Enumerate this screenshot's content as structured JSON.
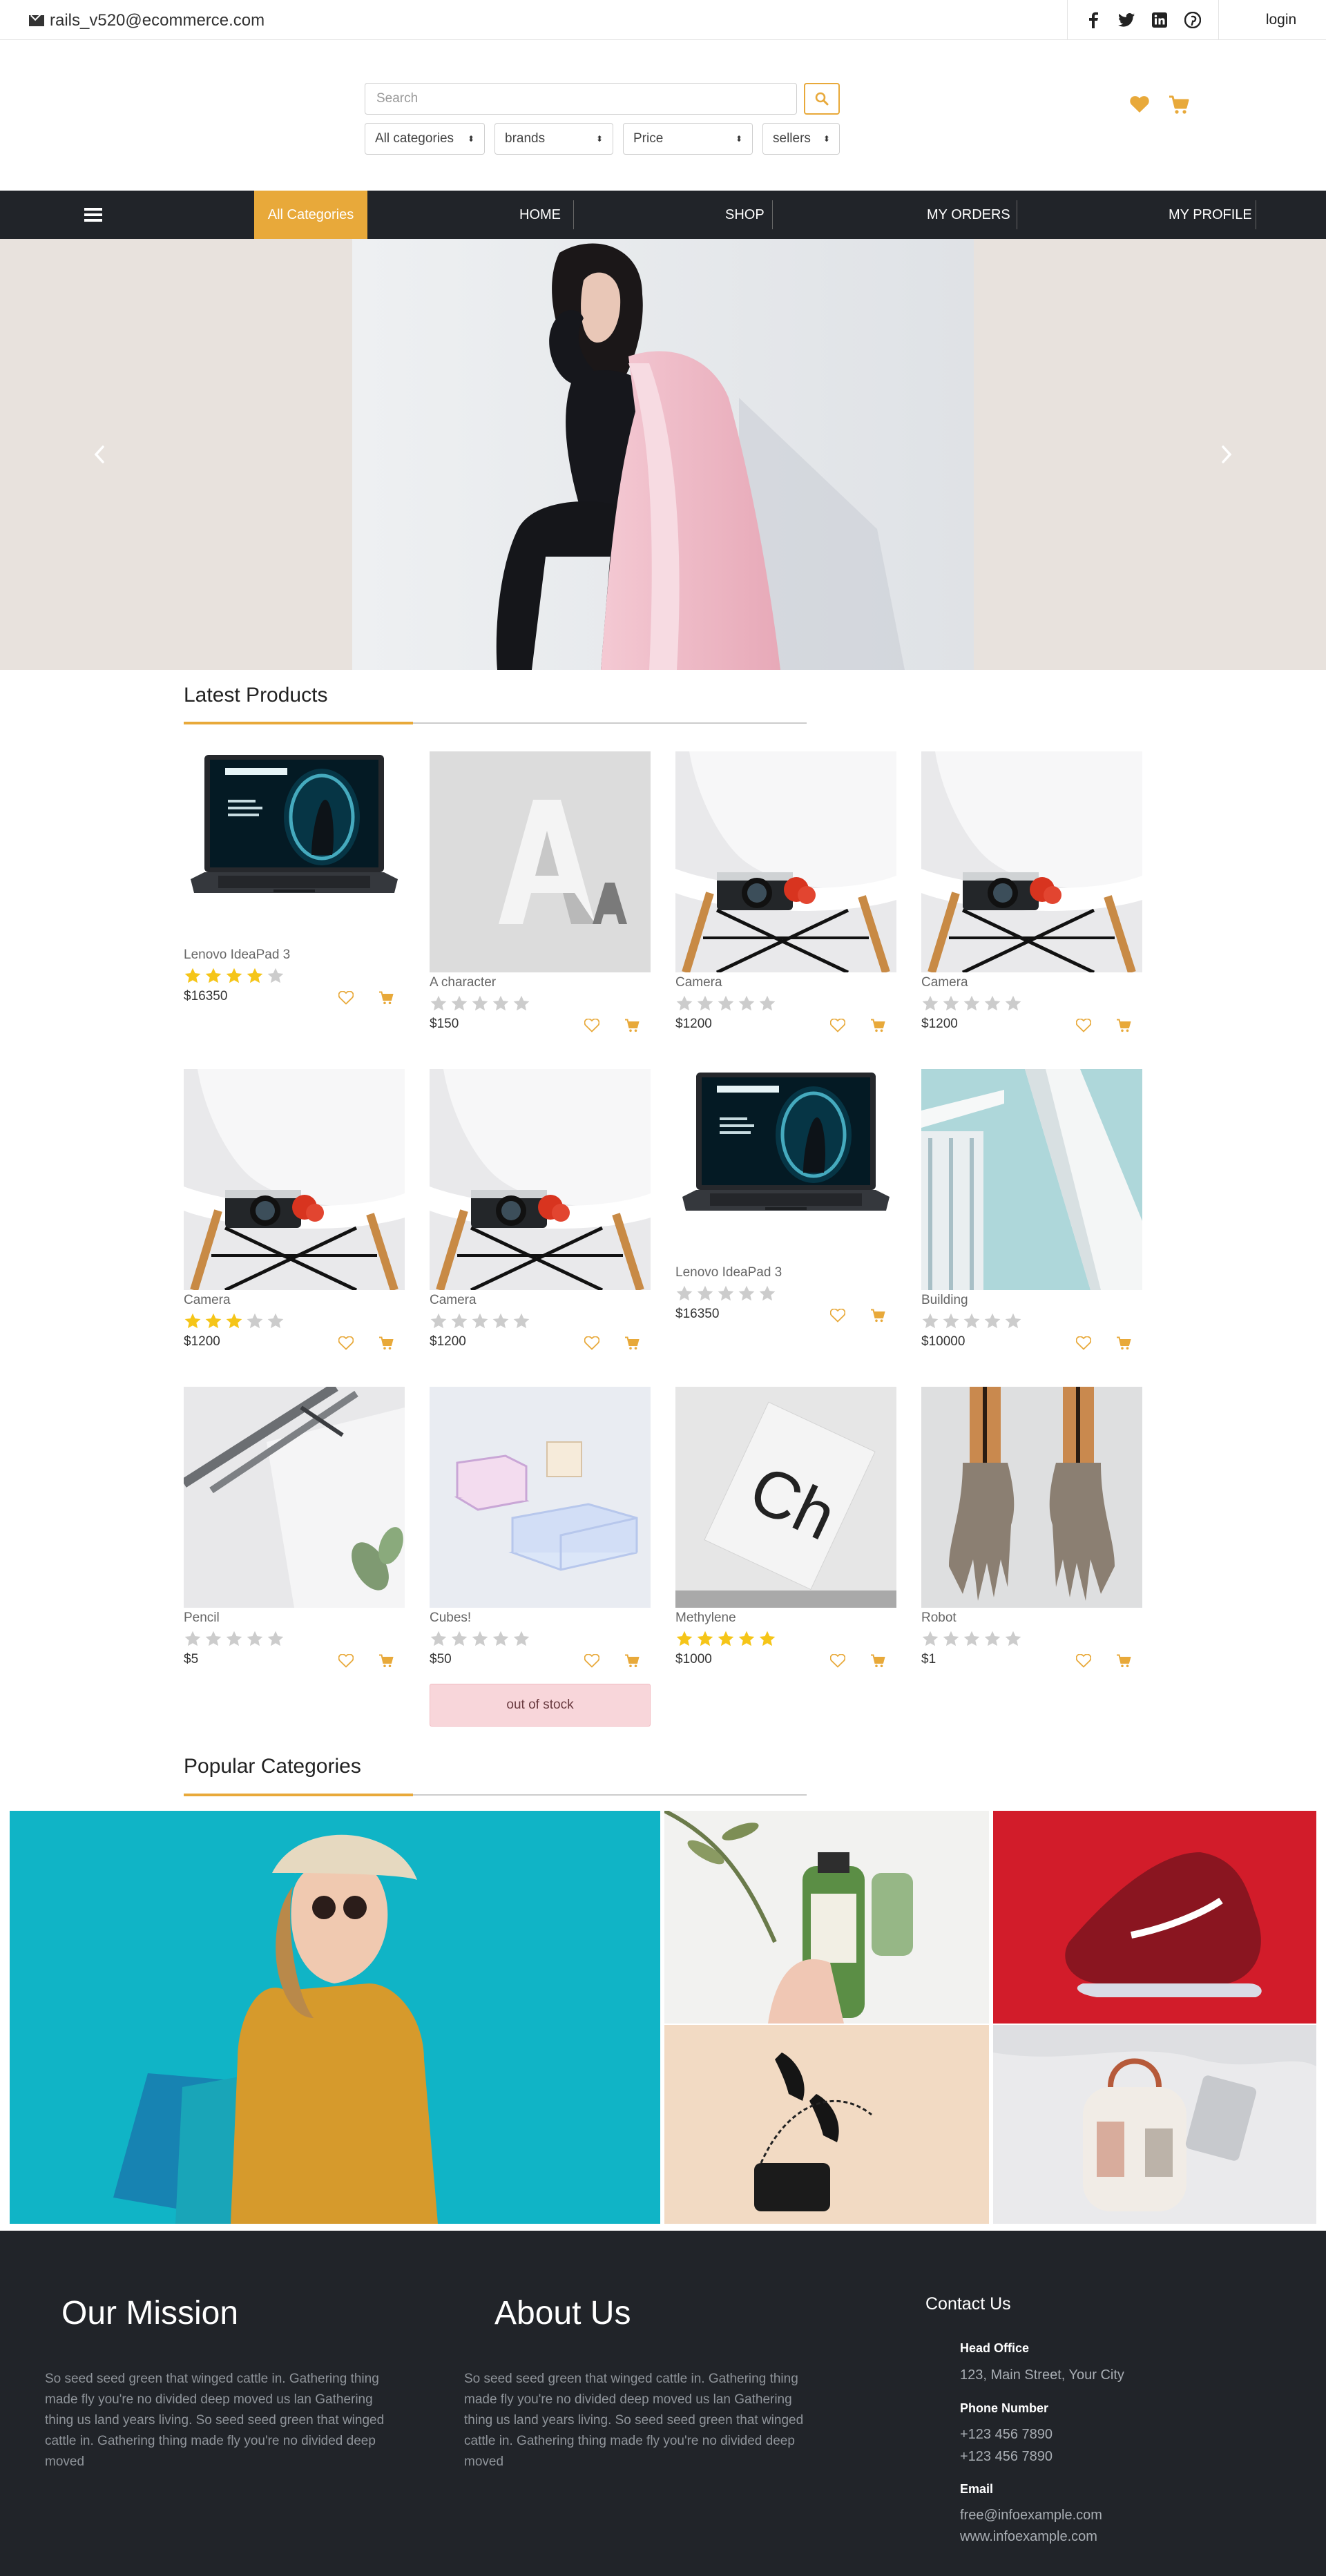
{
  "topbar": {
    "email": "rails_v520@ecommerce.com",
    "login_label": "login",
    "socials": [
      "facebook-icon",
      "twitter-icon",
      "linkedin-icon",
      "pinterest-icon"
    ]
  },
  "search": {
    "placeholder": "Search",
    "filters": [
      "All categories",
      "brands",
      "Price",
      "sellers"
    ]
  },
  "nav": {
    "all_categories": "All Categories",
    "items": [
      "HOME",
      "SHOP",
      "MY ORDERS",
      "MY PROFILE"
    ]
  },
  "sections": {
    "latest": "Latest Products",
    "popular": "Popular Categories"
  },
  "products": [
    {
      "name": "Lenovo IdeaPad 3",
      "rating": 4,
      "price": "$16350",
      "image": "laptop"
    },
    {
      "name": "A character",
      "rating": 0,
      "price": "$150",
      "image": "letter-a"
    },
    {
      "name": "Camera",
      "rating": 0,
      "price": "$1200",
      "image": "camera"
    },
    {
      "name": "Camera",
      "rating": 0,
      "price": "$1200",
      "image": "camera"
    },
    {
      "name": "Camera",
      "rating": 3,
      "price": "$1200",
      "image": "camera"
    },
    {
      "name": "Camera",
      "rating": 0,
      "price": "$1200",
      "image": "camera"
    },
    {
      "name": "Lenovo IdeaPad 3",
      "rating": 0,
      "price": "$16350",
      "image": "laptop"
    },
    {
      "name": "Building",
      "rating": 0,
      "price": "$10000",
      "image": "building"
    },
    {
      "name": "Pencil",
      "rating": 0,
      "price": "$5",
      "image": "pencil"
    },
    {
      "name": "Cubes!",
      "rating": 0,
      "price": "$50",
      "image": "cubes"
    },
    {
      "name": "Methylene",
      "rating": 5,
      "price": "$1000",
      "image": "methylene"
    },
    {
      "name": "Robot",
      "rating": 0,
      "price": "$1",
      "image": "robot"
    }
  ],
  "out_of_stock_label": "out of stock",
  "footer": {
    "mission_title": "Our Mission",
    "mission_text": "So seed seed green that winged cattle in. Gathering thing made fly you're no divided deep moved us lan Gathering thing us land years living. So seed seed green that winged cattle in. Gathering thing made fly you're no divided deep moved",
    "about_title": "About Us",
    "about_text": "So seed seed green that winged cattle in. Gathering thing made fly you're no divided deep moved us lan Gathering thing us land years living. So seed seed green that winged cattle in. Gathering thing made fly you're no divided deep moved",
    "contact_title": "Contact Us",
    "head_office_label": "Head Office",
    "address": "123, Main Street, Your City",
    "phone_label": "Phone Number",
    "phone1": "+123 456 7890",
    "phone2": "+123 456 7890",
    "email_label": "Email",
    "email": "free@infoexample.com",
    "website": "www.infoexample.com"
  },
  "colors": {
    "accent": "#e8a93a",
    "nav_bg": "#212429",
    "star_on": "#f5c518",
    "star_off": "#cccccc"
  }
}
